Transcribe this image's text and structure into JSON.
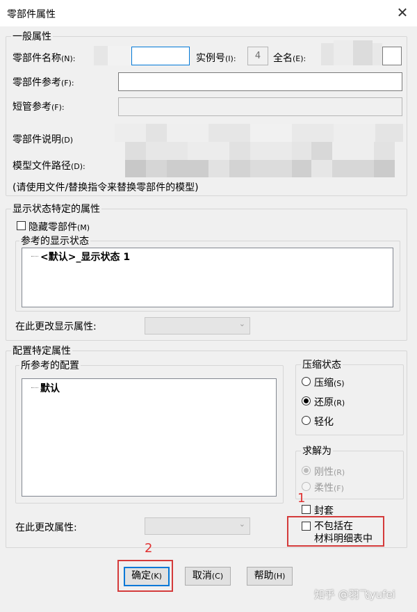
{
  "window": {
    "title": "零部件属性",
    "close_glyph": "✕"
  },
  "general": {
    "legend": "一般属性",
    "component_name_label": "零部件名称",
    "component_name_key": "(N):",
    "instance_label": "实例号",
    "instance_key": "(I):",
    "instance_value": "4",
    "full_name_label": "全名",
    "full_name_key": "(E):",
    "component_ref_label": "零部件参考",
    "component_ref_key": "(F):",
    "short_ref_label": "短管参考",
    "short_ref_key": "(F):",
    "description_label": "零部件说明",
    "description_key": "(D)",
    "model_path_label": "模型文件路径",
    "model_path_key": "(D):",
    "note": "(请使用文件/替换指令来替换零部件的模型)"
  },
  "display_state": {
    "legend": "显示状态特定的属性",
    "hide_label": "隐藏零部件",
    "hide_key": "(M)",
    "ref_group_legend": "参考的显示状态",
    "ref_item": "<默认>_显示状态 1",
    "change_label": "在此更改显示属性:"
  },
  "config": {
    "legend": "配置特定属性",
    "ref_group_legend": "所参考的配置",
    "ref_item": "默认",
    "change_label": "在此更改属性:"
  },
  "suppression": {
    "legend": "压缩状态",
    "options": [
      {
        "label": "压缩",
        "key": "(S)",
        "selected": false
      },
      {
        "label": "还原",
        "key": "(R)",
        "selected": true
      },
      {
        "label": "轻化",
        "key": "",
        "selected": false
      }
    ]
  },
  "solve_as": {
    "legend": "求解为",
    "options": [
      {
        "label": "刚性",
        "key": "(R)",
        "selected": true
      },
      {
        "label": "柔性",
        "key": "(F)",
        "selected": false
      }
    ]
  },
  "checkboxes": {
    "envelope": "封套",
    "exclude_bom_line1": "不包括在",
    "exclude_bom_line2": "材料明细表中"
  },
  "buttons": {
    "ok": "确定",
    "ok_key": "(K)",
    "cancel": "取消",
    "cancel_key": "(C)",
    "help": "帮助",
    "help_key": "(H)"
  },
  "annotations": {
    "num1": "1",
    "num2": "2",
    "color": "#d43a3a"
  },
  "watermark": "知乎 @羽飞yufei"
}
